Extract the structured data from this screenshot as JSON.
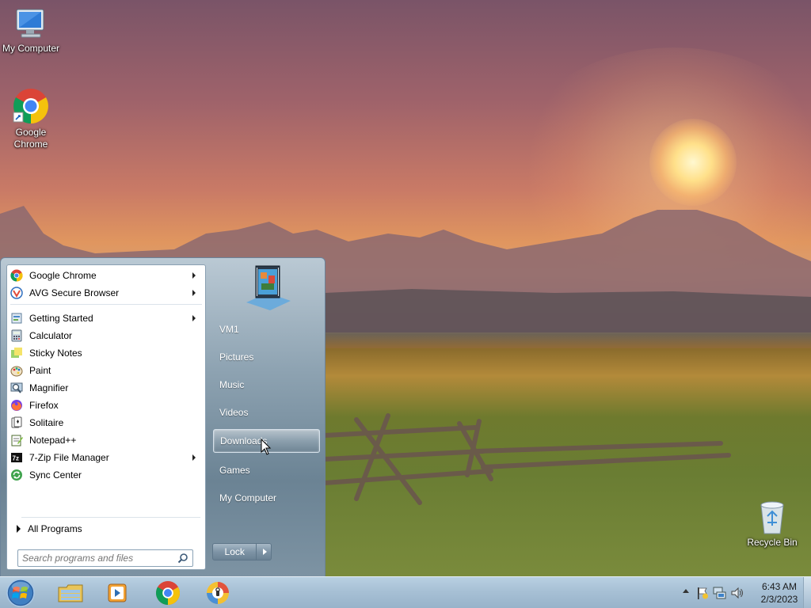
{
  "desktop": {
    "icons": [
      {
        "label": "My Computer"
      },
      {
        "label": "Google Chrome"
      },
      {
        "label": "Recycle Bin"
      }
    ]
  },
  "start_menu": {
    "pinned": [
      {
        "label": "Google Chrome",
        "icon": "chrome-icon",
        "submenu": true
      },
      {
        "label": "AVG Secure Browser",
        "icon": "avg-browser-icon",
        "submenu": true
      }
    ],
    "recent": [
      {
        "label": "Getting Started",
        "icon": "getting-started-icon",
        "submenu": true
      },
      {
        "label": "Calculator",
        "icon": "calculator-icon",
        "submenu": false
      },
      {
        "label": "Sticky Notes",
        "icon": "sticky-notes-icon",
        "submenu": false
      },
      {
        "label": "Paint",
        "icon": "paint-icon",
        "submenu": false
      },
      {
        "label": "Magnifier",
        "icon": "magnifier-icon",
        "submenu": false
      },
      {
        "label": "Firefox",
        "icon": "firefox-icon",
        "submenu": false
      },
      {
        "label": "Solitaire",
        "icon": "solitaire-icon",
        "submenu": false
      },
      {
        "label": "Notepad++",
        "icon": "notepadpp-icon",
        "submenu": false
      },
      {
        "label": "7-Zip File Manager",
        "icon": "7zip-icon",
        "submenu": true
      },
      {
        "label": "Sync Center",
        "icon": "sync-center-icon",
        "submenu": false
      }
    ],
    "all_programs_label": "All Programs",
    "search_placeholder": "Search programs and files",
    "places": [
      {
        "label": "VM1"
      },
      {
        "label": "Pictures"
      },
      {
        "label": "Music"
      },
      {
        "label": "Videos"
      },
      {
        "label": "Downloads"
      },
      {
        "label": "Games"
      },
      {
        "label": "My Computer"
      }
    ],
    "hovered_place": "Downloads",
    "lock_label": "Lock"
  },
  "taskbar": {
    "pinned_apps": [
      "windows-explorer-icon",
      "media-player-icon",
      "chrome-icon",
      "vpn-icon"
    ],
    "clock": {
      "time": "6:43 AM",
      "date": "2/3/2023"
    }
  },
  "colors": {
    "taskbar": "#a7c0d5",
    "start_menu_right_pane": "#7d93a3"
  }
}
